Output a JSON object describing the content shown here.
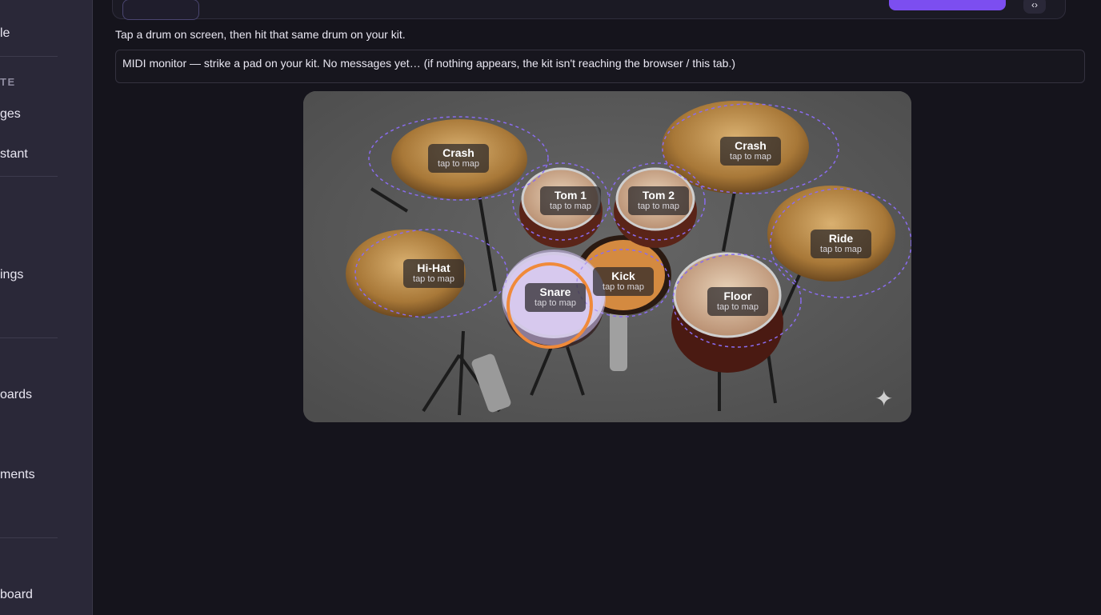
{
  "sidebar": {
    "items": [
      {
        "label": "le"
      },
      {
        "label": "ges"
      },
      {
        "label": "stant"
      },
      {
        "label": "ings"
      },
      {
        "label": "oards"
      },
      {
        "label": "ments"
      },
      {
        "label": "board"
      }
    ],
    "section_label": "TE"
  },
  "instruction": "Tap a drum on screen, then hit that same drum on your kit.",
  "midi_monitor": "MIDI monitor — strike a pad on your kit. No messages yet… (if nothing appears, the kit isn't reaching the browser / this tab.)",
  "kit": {
    "hint": "tap to map",
    "selected": "Snare",
    "pads": [
      {
        "name": "Crash"
      },
      {
        "name": "Crash"
      },
      {
        "name": "Tom 1"
      },
      {
        "name": "Tom 2"
      },
      {
        "name": "Ride"
      },
      {
        "name": "Hi-Hat"
      },
      {
        "name": "Snare"
      },
      {
        "name": "Kick"
      },
      {
        "name": "Floor"
      }
    ]
  },
  "colors": {
    "accent": "#7c4ef0",
    "selected_ring": "#f08a3a",
    "zone_outline": "#8a6cf0"
  }
}
